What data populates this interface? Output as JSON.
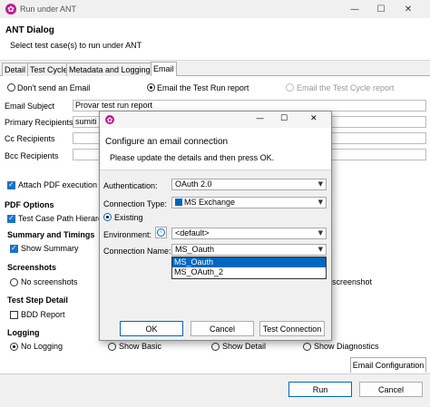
{
  "window": {
    "title": "Run under ANT",
    "header_title": "ANT Dialog",
    "header_subtitle": "Select test case(s) to run under ANT",
    "controls": [
      "—",
      "☐",
      "✕"
    ]
  },
  "tabs": [
    "Detail",
    "Test Cycle",
    "Metadata and Logging",
    "Email"
  ],
  "active_tab": "Email",
  "email": {
    "radio_options": [
      "Don't send an Email",
      "Email the Test Run report",
      "Email the Test Cycle report"
    ],
    "selected_option": "Email the Test Run report",
    "subject_label": "Email Subject",
    "subject_value": "Provar test run report",
    "primary_label": "Primary Recipients",
    "primary_value": "sumiti",
    "cc_label": "Cc Recipients",
    "bcc_label": "Bcc Recipients",
    "attach_pdf_label": "Attach PDF execution re",
    "attach_pdf_checked": true
  },
  "pdf_options": {
    "title": "PDF Options",
    "hierarchy_label": "Test Case Path Hierarch",
    "summary_title": "Summary and Timings",
    "show_summary_label": "Show Summary"
  },
  "screenshots": {
    "title": "Screenshots",
    "no_screenshots_label": "No screenshots",
    "right_fragment": "screenshot"
  },
  "step_detail": {
    "title": "Test Step Detail",
    "bdd_label": "BDD Report"
  },
  "logging": {
    "title": "Logging",
    "options": [
      "No Logging",
      "Show Basic",
      "Show Detail",
      "Show Diagnostics"
    ],
    "selected": "No Logging"
  },
  "footer": {
    "email_config_label": "Email Configuration",
    "run_label": "Run",
    "cancel_label": "Cancel"
  },
  "modal": {
    "title": "Configure an email connection",
    "subtitle": "Please update the details and then press OK.",
    "auth_label": "Authentication:",
    "auth_value": "OAuth 2.0",
    "conn_type_label": "Connection Type:",
    "conn_type_value": "MS Exchange",
    "existing_label": "Existing",
    "env_label": "Environment:",
    "env_value": "<default>",
    "conn_name_label": "Connection Name:",
    "conn_name_value": "MS_Oauth",
    "dropdown_options": [
      "MS_Oauth",
      "MS_OAuth_2"
    ],
    "dropdown_selected": "MS_Oauth",
    "ok_label": "OK",
    "cancel_label": "Cancel",
    "test_label": "Test Connection",
    "controls": [
      "—",
      "☐",
      "✕"
    ]
  },
  "colors": {
    "accent": "#0067c0",
    "brand": "#c2188f",
    "checkbox": "#1a73c6"
  }
}
